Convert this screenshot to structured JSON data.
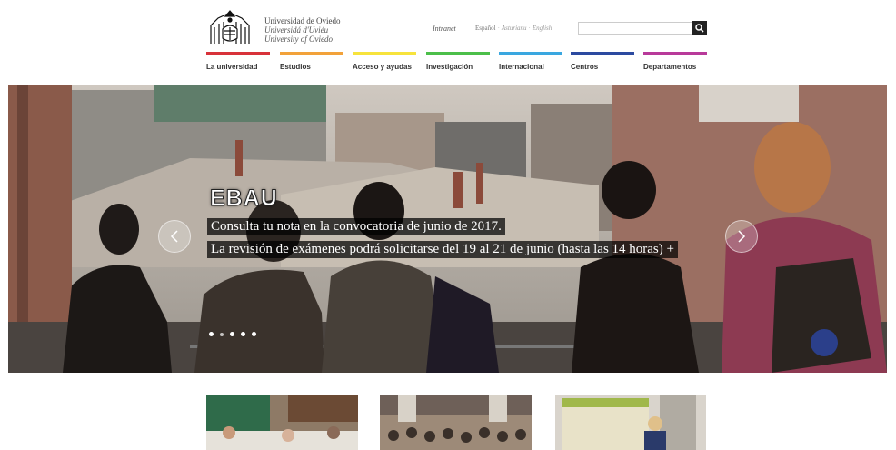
{
  "header": {
    "university_names": [
      "Universidad de Oviedo",
      "Universidá d'Uviéu",
      "University of Oviedo"
    ],
    "intranet_label": "Intranet",
    "languages": [
      "Español",
      "Asturianu",
      "English"
    ],
    "search": {
      "placeholder": "",
      "button_icon": "search-icon"
    }
  },
  "nav": {
    "items": [
      {
        "label": "La universidad",
        "color": "#d8323a"
      },
      {
        "label": "Estudios",
        "color": "#f2a23a"
      },
      {
        "label": "Acceso y ayudas",
        "color": "#f7e33c"
      },
      {
        "label": "Investigación",
        "color": "#4cbf4a"
      },
      {
        "label": "Internacional",
        "color": "#3aa7e0"
      },
      {
        "label": "Centros",
        "color": "#2c4aa0"
      },
      {
        "label": "Departamentos",
        "color": "#b83a9a"
      }
    ]
  },
  "hero": {
    "title": "EBAU",
    "line1": "Consulta tu nota en la convocatoria de junio de 2017.",
    "line2": "La revisión de exámenes podrá solicitarse del 19 al 21 de junio (hasta las 14 horas)  +",
    "slide_count": 5,
    "active_slide": 2
  }
}
